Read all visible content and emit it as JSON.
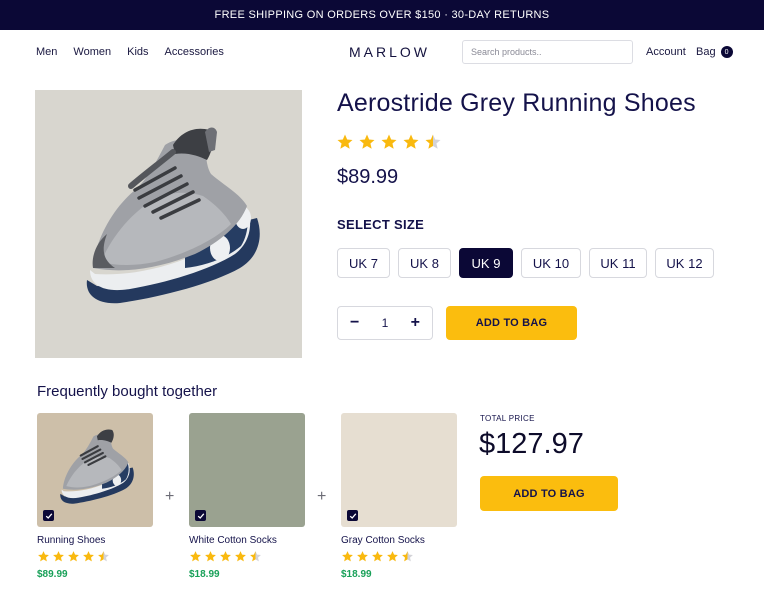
{
  "banner": {
    "text": "FREE SHIPPING ON ORDERS OVER $150 · 30-DAY RETURNS"
  },
  "nav": {
    "links": [
      "Men",
      "Women",
      "Kids",
      "Accessories"
    ],
    "logo": "MARLOW",
    "search_placeholder": "Search products..",
    "account": "Account",
    "bag": "Bag",
    "bag_count": "0"
  },
  "product": {
    "title": "Aerostride Grey Running Shoes",
    "rating": 4.5,
    "price": "$89.99",
    "size_label": "SELECT SIZE",
    "sizes": [
      "UK 7",
      "UK 8",
      "UK 9",
      "UK 10",
      "UK 11",
      "UK 12"
    ],
    "selected_size": "UK 9",
    "quantity": "1",
    "decrement": "−",
    "increment": "+",
    "add_to_bag": "ADD TO BAG"
  },
  "fbt": {
    "title": "Frequently bought together",
    "plus": "+",
    "items": [
      {
        "name": "Running Shoes",
        "price": "$89.99",
        "rating": 4.5,
        "image_color": "#cdbfa9",
        "checked": true
      },
      {
        "name": "White Cotton Socks",
        "price": "$18.99",
        "rating": 4.5,
        "image_color": "#9aa290",
        "checked": true
      },
      {
        "name": "Gray Cotton Socks",
        "price": "$18.99",
        "rating": 4.5,
        "image_color": "#e6ded1",
        "checked": true
      }
    ],
    "total_label": "TOTAL PRICE",
    "total_price": "$127.97",
    "add_to_bag": "ADD TO BAG"
  },
  "colors": {
    "brand_navy": "#0b0836",
    "accent_yellow": "#fbbd0e",
    "star": "#f9b90f",
    "price_green": "#18a058"
  }
}
